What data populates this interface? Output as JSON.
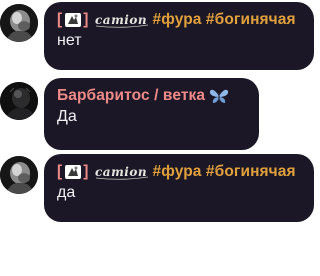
{
  "messages": [
    {
      "sender": {
        "bracket_open": "[",
        "bracket_close": "]",
        "nick": "camion",
        "tags": "#фура #богинячая"
      },
      "text": "нет"
    },
    {
      "sender": {
        "name": "Барбаритос / ветка",
        "icon": "butterfly-icon"
      },
      "text": "Да"
    },
    {
      "sender": {
        "bracket_open": "[",
        "bracket_close": "]",
        "nick": "camion",
        "tags": "#фура #богинячая"
      },
      "text": "да"
    }
  ],
  "colors": {
    "bubble_bg": "#1b1726",
    "name_pink": "#ee8a88",
    "tags_orange": "#e0a03b",
    "message_text": "#f2f2f4"
  }
}
